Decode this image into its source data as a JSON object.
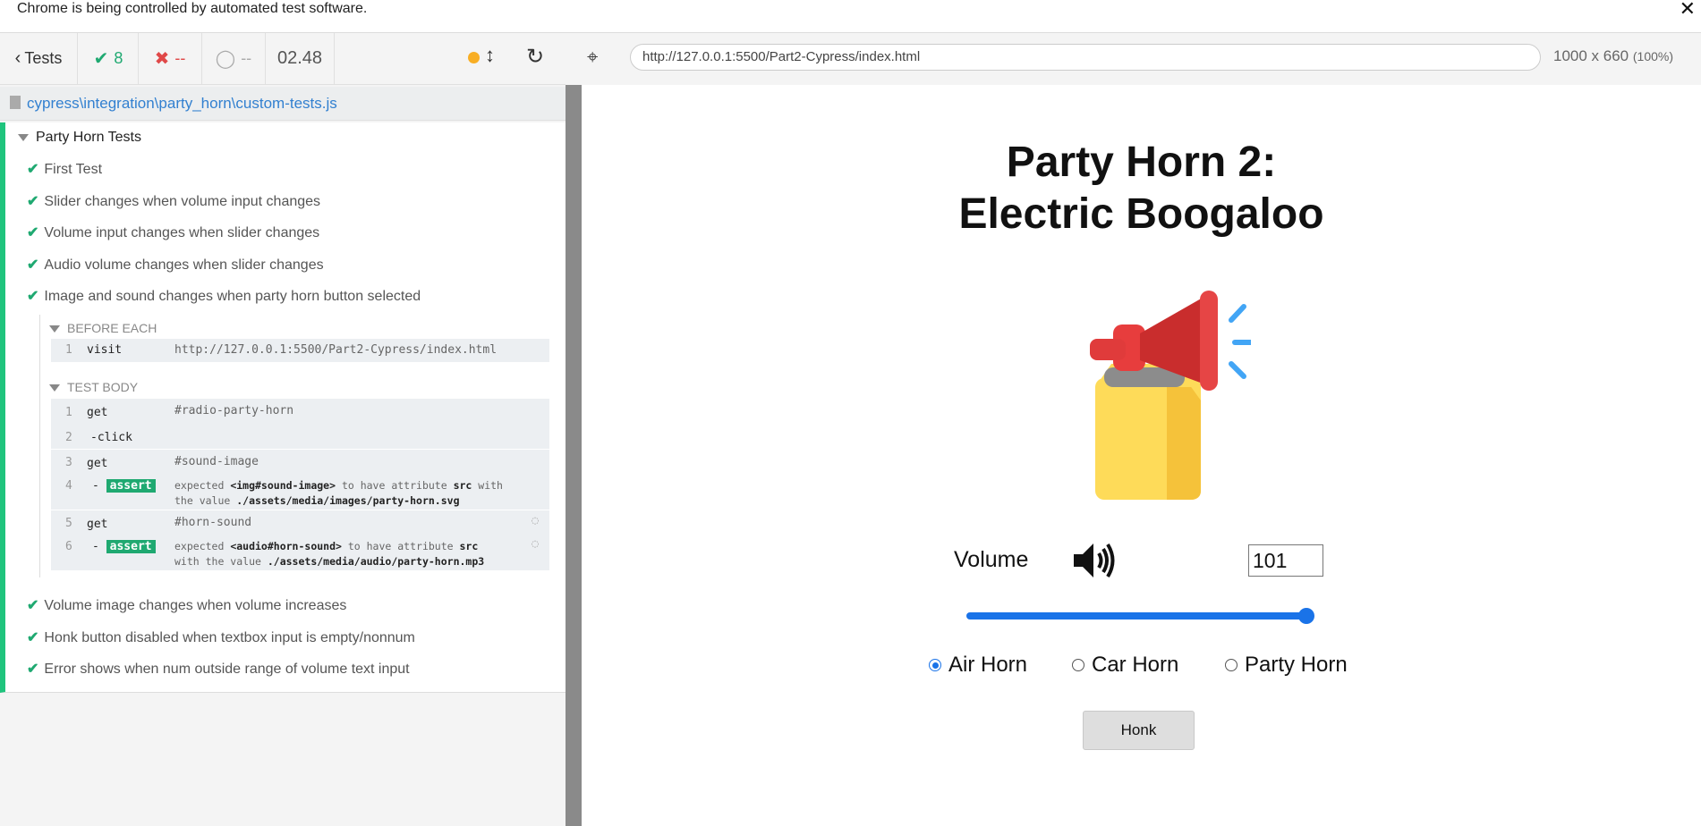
{
  "infobar": {
    "message": "Chrome is being controlled by automated test software.",
    "close": "✕"
  },
  "reporter": {
    "tests_label": "Tests",
    "passed": "8",
    "failed": "--",
    "pending": "--",
    "duration": "02.48",
    "spec_path": "cypress\\integration\\party_horn\\custom-tests.js",
    "suite_title": "Party Horn Tests",
    "tests": [
      "First Test",
      "Slider changes when volume input changes",
      "Volume input changes when slider changes",
      "Audio volume changes when slider changes",
      "Image and sound changes when party horn button selected",
      "Volume image changes when volume increases",
      "Honk button disabled when textbox input is empty/nonnum",
      "Error shows when num outside range of volume text input"
    ],
    "before_each_label": "BEFORE EACH",
    "test_body_label": "TEST BODY",
    "commands": {
      "c1": {
        "num": "1",
        "name": "visit",
        "msg": "http://127.0.0.1:5500/Part2-Cypress/index.html"
      },
      "c2": {
        "num": "1",
        "name": "get",
        "msg": "#radio-party-horn"
      },
      "c3": {
        "num": "2",
        "name": "-click"
      },
      "c4": {
        "num": "3",
        "name": "get",
        "msg": "#sound-image"
      },
      "c5": {
        "num": "4",
        "name": "-",
        "badge": "assert",
        "l1a": "expected ",
        "l1b": "<img#sound-image>",
        "l1c": " to have attribute ",
        "l1d": "src",
        "l1e": " with",
        "l2a": "the value ",
        "l2b": "./assets/media/images/party-horn.svg"
      },
      "c6": {
        "num": "5",
        "name": "get",
        "msg": "#horn-sound"
      },
      "c7": {
        "num": "6",
        "name": "-",
        "badge": "assert",
        "l1a": "expected ",
        "l1b": "<audio#horn-sound>",
        "l1c": " to have attribute ",
        "l1d": "src",
        "l2a": "with the value ",
        "l2b": "./assets/media/audio/party-horn.mp3"
      }
    }
  },
  "aut": {
    "url": "http://127.0.0.1:5500/Part2-Cypress/index.html",
    "viewport": "1000 x 660",
    "zoom": "(100%)",
    "title_line1": "Party Horn 2:",
    "title_line2": "Electric Boogaloo",
    "volume_label": "Volume",
    "volume_value": "101",
    "slider_fraction": 1.0,
    "radios": [
      "Air Horn",
      "Car Horn",
      "Party Horn"
    ],
    "selected_radio": "Air Horn",
    "honk_label": "Honk"
  },
  "colors": {
    "accent": "#1a73e8",
    "pass": "#1fa971",
    "fail": "#e04848",
    "running": "#f8ae24"
  }
}
